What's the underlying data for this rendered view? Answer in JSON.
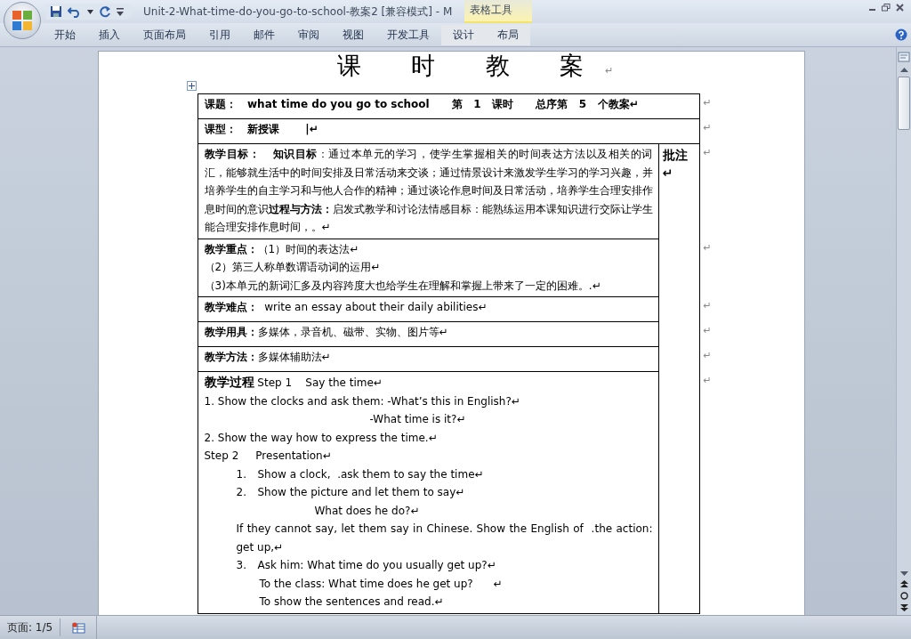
{
  "title_bar": {
    "title": "Unit-2-What-time-do-you-go-to-school-教案2 [兼容模式] - M",
    "context_tab": "表格工具"
  },
  "ribbon_tabs": [
    {
      "label": "开始",
      "selected": false
    },
    {
      "label": "插入",
      "selected": false
    },
    {
      "label": "页面布局",
      "selected": false
    },
    {
      "label": "引用",
      "selected": false
    },
    {
      "label": "邮件",
      "selected": false
    },
    {
      "label": "审阅",
      "selected": false
    },
    {
      "label": "视图",
      "selected": false
    },
    {
      "label": "开发工具",
      "selected": false
    },
    {
      "label": "设计",
      "selected": false,
      "kind": "context"
    },
    {
      "label": "布局",
      "selected": false,
      "kind": "context"
    }
  ],
  "document": {
    "heading": "课 时 教 案",
    "heading_mark": "↵",
    "note": "批注↵",
    "rows": [
      {
        "kind": "full",
        "end_mark": "↵",
        "paragraphs": [
          {
            "kind": "plain",
            "text": "课题：   what time do you go to school      第   1   课时      总序第   5   个教案↵"
          }
        ]
      },
      {
        "kind": "full",
        "end_mark": "↵",
        "paragraphs": [
          {
            "kind": "plain",
            "text": "课型：   新授课       |↵"
          }
        ]
      },
      {
        "kind": "left",
        "end_mark": "↵",
        "paragraphs": [
          {
            "kind": "plain",
            "text": "**教学目标：   知识目标**：通过本单元的学习，使学生掌握相关的时间表达方法以及相关的词汇，能够就生活中的时间安排及日常活动来交谈；通过情景设计来激发学生学习的学习兴趣，并培养学生的自主学习和与他人合作的精神；通过谈论作息时间及日常活动，培养学生合理安排作息时间的意识**过程与方法：**启发式教学和讨论法情感目标：能熟练运用本课知识进行交际让学生能合理安排作息时间，。↵"
          }
        ]
      },
      {
        "kind": "left",
        "end_mark": "↵",
        "paragraphs": [
          {
            "kind": "plain",
            "text": "**教学重点：**（1）时间的表达法↵"
          },
          {
            "kind": "plain",
            "text": "（2）第三人称单数谓语动词的运用↵"
          },
          {
            "kind": "plain",
            "text": "（3)本单元的新词汇多及内容跨度大也给学生在理解和掌握上带来了一定的困难。.↵"
          }
        ]
      },
      {
        "kind": "left",
        "end_mark": "↵",
        "paragraphs": [
          {
            "kind": "plain",
            "text": "**教学难点：**  write an essay about their daily abilities↵"
          }
        ]
      },
      {
        "kind": "left",
        "end_mark": "↵",
        "paragraphs": [
          {
            "kind": "plain",
            "text": "**教学用具：**多媒体，录音机、磁带、实物、图片等↵"
          }
        ]
      },
      {
        "kind": "left",
        "end_mark": "↵",
        "paragraphs": [
          {
            "kind": "plain",
            "text": "**教学方法：**多媒体辅助法↵"
          }
        ]
      },
      {
        "kind": "left",
        "end_mark": "↵",
        "paragraphs": [
          {
            "kind": "lead",
            "text": "**教学过程** Step 1    Say the time↵"
          },
          {
            "kind": "plain",
            "text": "1. Show the clocks and ask them: -What’s this in English?↵"
          },
          {
            "kind": "offset",
            "text": "-What time is it?↵"
          },
          {
            "kind": "plain",
            "text": "2. Show the way how to express the time.↵"
          },
          {
            "kind": "plain",
            "text": "Step 2     Presentation↵"
          },
          {
            "kind": "item",
            "number": "1.",
            "text": "Show a clock,  .ask them to say the time↵"
          },
          {
            "kind": "item",
            "number": "2.",
            "text": "Show the picture and let them to say↵"
          },
          {
            "kind": "deep",
            "text": "What does he do?↵"
          },
          {
            "kind": "indent",
            "text": "If they cannot say, let them say in Chinese. Show the English of  .the action: get up,↵"
          },
          {
            "kind": "item",
            "number": "3.",
            "text": "Ask him: What time do you usually get up?↵"
          },
          {
            "kind": "sub",
            "text": "To the class: What time does he get up?      ↵"
          },
          {
            "kind": "sub",
            "text": "To show the sentences and read.↵"
          }
        ]
      }
    ]
  },
  "status_bar": {
    "page": "页面: 1/5"
  }
}
